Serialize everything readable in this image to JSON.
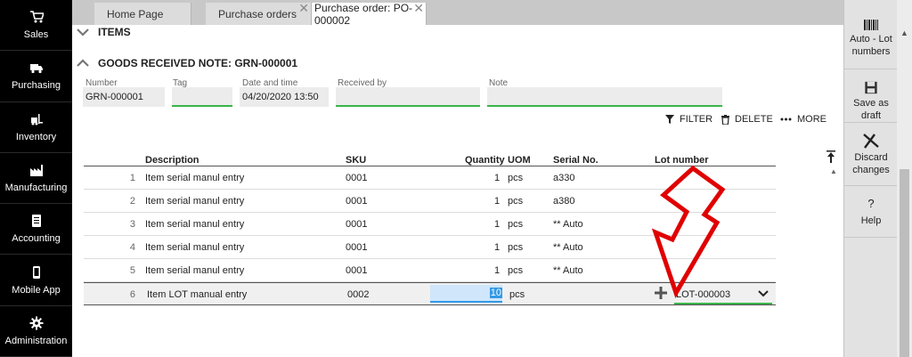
{
  "nav": [
    {
      "label": "Sales",
      "icon": "cart-icon"
    },
    {
      "label": "Purchasing",
      "icon": "truck-icon"
    },
    {
      "label": "Inventory",
      "icon": "forklift-icon"
    },
    {
      "label": "Manufacturing",
      "icon": "factory-icon"
    },
    {
      "label": "Accounting",
      "icon": "ledger-icon"
    },
    {
      "label": "Mobile App",
      "icon": "phone-icon"
    },
    {
      "label": "Administration",
      "icon": "gear-icon"
    }
  ],
  "tabs": [
    {
      "label": "Home Page"
    },
    {
      "label": "Purchase orders"
    },
    {
      "label": "Purchase order: PO-000002"
    }
  ],
  "sections": {
    "items": "ITEMS",
    "grn": "GOODS RECEIVED NOTE: GRN-000001"
  },
  "fields": {
    "number": {
      "label": "Number",
      "value": "GRN-000001"
    },
    "tag": {
      "label": "Tag",
      "value": ""
    },
    "datetime": {
      "label": "Date and time",
      "value": "04/20/2020 13:50"
    },
    "received_by": {
      "label": "Received by",
      "value": ""
    },
    "note": {
      "label": "Note",
      "value": ""
    }
  },
  "toolbar": {
    "filter": "FILTER",
    "delete": "DELETE",
    "more": "MORE"
  },
  "columns": {
    "description": "Description",
    "sku": "SKU",
    "quantity": "Quantity",
    "uom": "UOM",
    "serial": "Serial No.",
    "lot": "Lot number"
  },
  "rows": [
    {
      "n": "1",
      "desc": "Item serial manul entry",
      "sku": "0001",
      "qty": "1",
      "uom": "pcs",
      "serial": "a330",
      "lot": ""
    },
    {
      "n": "2",
      "desc": "Item serial manul entry",
      "sku": "0001",
      "qty": "1",
      "uom": "pcs",
      "serial": "a380",
      "lot": ""
    },
    {
      "n": "3",
      "desc": "Item serial manul entry",
      "sku": "0001",
      "qty": "1",
      "uom": "pcs",
      "serial": "** Auto",
      "lot": ""
    },
    {
      "n": "4",
      "desc": "Item serial manul entry",
      "sku": "0001",
      "qty": "1",
      "uom": "pcs",
      "serial": "** Auto",
      "lot": ""
    },
    {
      "n": "5",
      "desc": "Item serial manul entry",
      "sku": "0001",
      "qty": "1",
      "uom": "pcs",
      "serial": "** Auto",
      "lot": ""
    },
    {
      "n": "6",
      "desc": "Item LOT manual entry",
      "sku": "0002",
      "qty": "10",
      "uom": "pcs",
      "serial": "",
      "lot": "LOT-000003"
    }
  ],
  "actions": [
    {
      "label": "Auto - Lot numbers",
      "icon": "barcode-icon"
    },
    {
      "label": "Save as draft",
      "icon": "save-icon"
    },
    {
      "label": "Discard changes",
      "icon": "discard-icon"
    },
    {
      "label": "Help",
      "icon": "help-icon"
    }
  ],
  "colors": {
    "accent_green": "#39b54a",
    "arrow_red": "#e00000",
    "selection_blue": "#3399e6"
  }
}
